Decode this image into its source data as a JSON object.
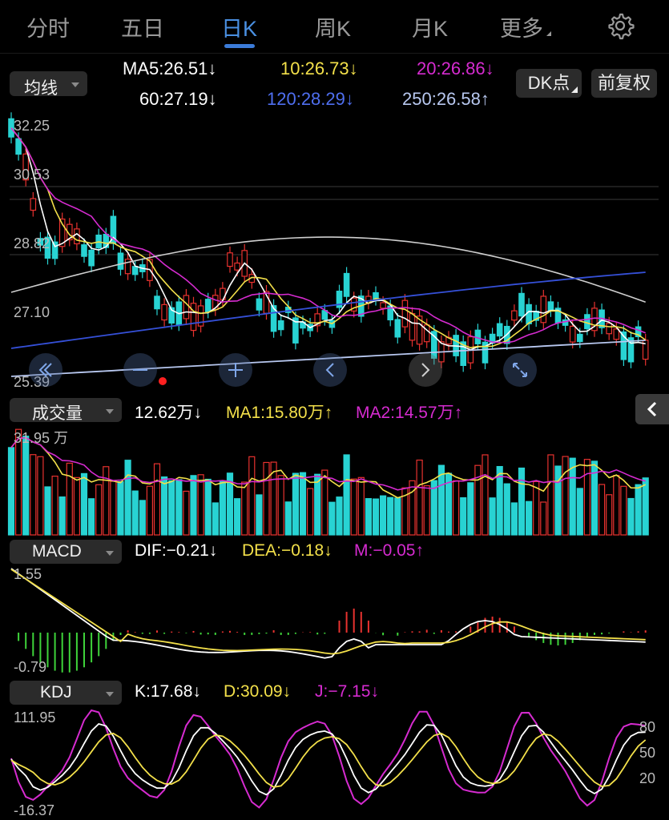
{
  "tabs": [
    {
      "label": "分时"
    },
    {
      "label": "五日"
    },
    {
      "label": "日K"
    },
    {
      "label": "周K"
    },
    {
      "label": "月K"
    },
    {
      "label": "更多"
    }
  ],
  "ma_selector": "均线",
  "ma_values": {
    "ma5": "MA5:26.51↓",
    "ma10": "10:26.73↓",
    "ma20": "20:26.86↓",
    "ma60": "60:27.19↓",
    "ma120": "120:28.29↓",
    "ma250": "250:26.58↑"
  },
  "dk_button": "DK点",
  "fq_button": "前复权",
  "price_axis": {
    "top": "32.25",
    "l2": "30.53",
    "l3": "28.82",
    "l4": "27.10",
    "bottom": "25.39"
  },
  "volume": {
    "selector": "成交量",
    "current": "12.62万↓",
    "ma1": "MA1:15.80万↑",
    "ma2": "MA2:14.57万↑",
    "max_label": "31.95 万"
  },
  "macd": {
    "selector": "MACD",
    "dif": "DIF:−0.21↓",
    "dea": "DEA:−0.18↓",
    "m": "M:−0.05↑",
    "top_label": "1.55",
    "bottom_label": "-0.79"
  },
  "kdj": {
    "selector": "KDJ",
    "k": "K:17.68↓",
    "d": "D:30.09↓",
    "j": "J:−7.15↓",
    "top_label": "111.95",
    "bottom_label": "-16.37",
    "ref80": "80",
    "ref50": "50",
    "ref20": "20"
  },
  "colors": {
    "up": "#e8322f",
    "down": "#28d3d3",
    "ma5": "#ffffff",
    "ma10": "#f3e04a",
    "ma20": "#d62bd0",
    "ma60": "#cfcfcf",
    "ma120": "#3550d8",
    "ma250": "#b8c8f0",
    "accent": "#3b7bd8"
  },
  "chart_data": {
    "type": "candlestick",
    "y_range": [
      25.39,
      32.25
    ],
    "ma_lines": [
      "MA5",
      "MA10",
      "MA20",
      "MA60",
      "MA120",
      "MA250"
    ]
  },
  "icons": [
    "gear-icon",
    "zoom-out-left-icon",
    "zoom-out-icon",
    "zoom-in-icon",
    "pan-left-icon",
    "pan-right-icon",
    "fullscreen-icon",
    "collapse-left-icon"
  ]
}
